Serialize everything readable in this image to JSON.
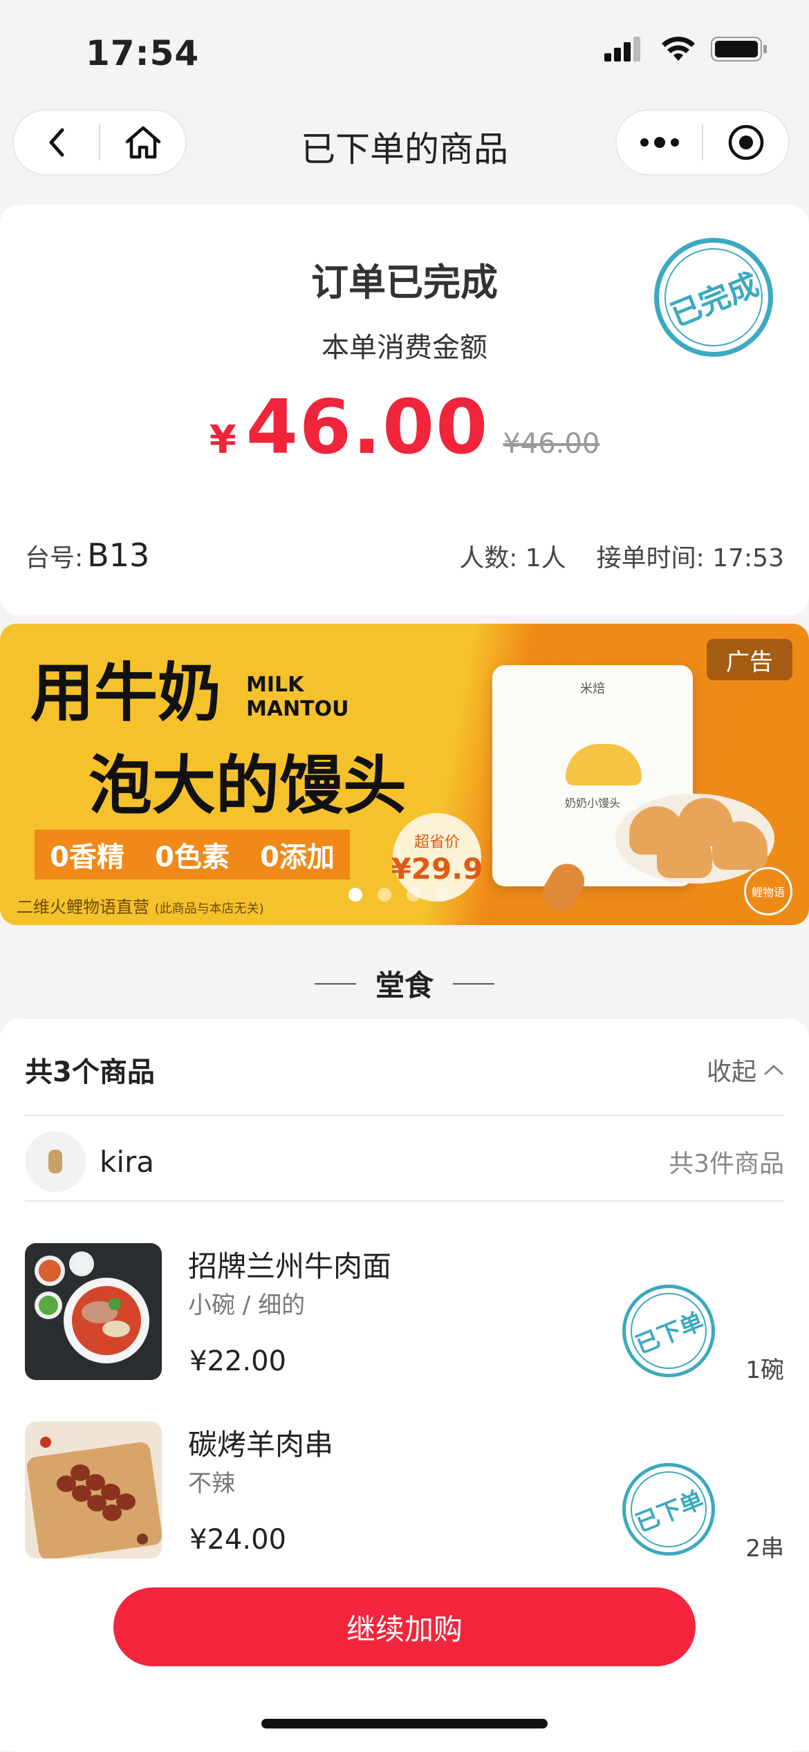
{
  "status_bar": {
    "time": "17:54"
  },
  "nav": {
    "title": "已下单的商品",
    "back_icon": "back-icon",
    "home_icon": "home-icon",
    "more_icon": "more-icon",
    "target_icon": "target-icon"
  },
  "summary": {
    "status": "订单已完成",
    "amount_label": "本单消费金额",
    "currency": "¥",
    "amount": "46.00",
    "original": "¥46.00",
    "stamp": "已完成",
    "table_label": "台号:",
    "table_value": "B13",
    "people": "人数: 1人",
    "order_time": "接单时间: 17:53"
  },
  "ad": {
    "tag": "广告",
    "headline1": "用牛奶",
    "headline2": "泡大的馒头",
    "english": "MILK\nMANTOU",
    "features": [
      "0香精",
      "0色素",
      "0添加"
    ],
    "footer": "二维火鲤物语直营",
    "footer_note": "(此商品与本店无关)",
    "price_label": "超省价",
    "price": "¥29.9",
    "bag_brand": "米焙",
    "bag_name": "奶奶小馒头",
    "logo": "鲤物语"
  },
  "section": {
    "title": "堂食"
  },
  "items_header": {
    "count_label": "共3个商品",
    "collapse_label": "收起"
  },
  "user": {
    "name": "kira",
    "count": "共3件商品"
  },
  "items": [
    {
      "name": "招牌兰州牛肉面",
      "spec": "小碗 / 细的",
      "price": "¥22.00",
      "qty": "1碗",
      "stamp": "已下单"
    },
    {
      "name": "碳烤羊肉串",
      "spec": "不辣",
      "price": "¥24.00",
      "qty": "2串",
      "stamp": "已下单"
    }
  ],
  "cta": {
    "label": "继续加购"
  },
  "colors": {
    "accent": "#f2253d",
    "stamp": "#3ba9c0",
    "banner_yellow": "#f6c22c",
    "banner_orange": "#f08a18"
  }
}
